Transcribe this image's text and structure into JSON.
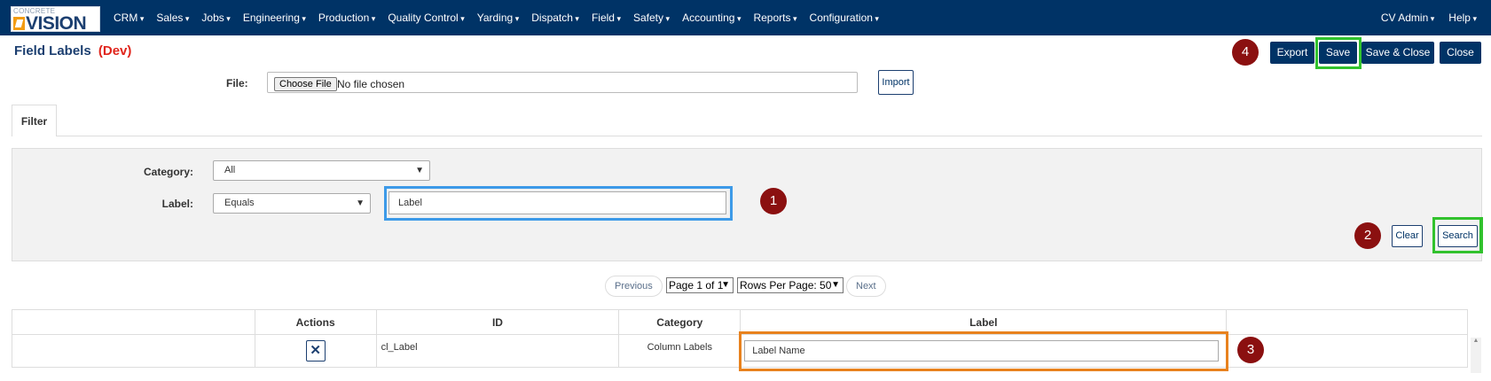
{
  "nav": {
    "logo_small": "CONCRETE",
    "logo_big": "VISION",
    "items": [
      "CRM",
      "Sales",
      "Jobs",
      "Engineering",
      "Production",
      "Quality Control",
      "Yarding",
      "Dispatch",
      "Field",
      "Safety",
      "Accounting",
      "Reports",
      "Configuration"
    ],
    "right_items": [
      "CV Admin",
      "Help"
    ]
  },
  "page": {
    "title": "Field Labels",
    "env": "(Dev)"
  },
  "toolbar": {
    "export": "Export",
    "save": "Save",
    "save_close": "Save & Close",
    "close": "Close"
  },
  "file": {
    "label": "File:",
    "choose": "Choose File",
    "none": "No file chosen",
    "import": "Import"
  },
  "tabs": [
    "Filter"
  ],
  "filter": {
    "category_label": "Category:",
    "category_value": "All",
    "label_label": "Label:",
    "operator_value": "Equals",
    "label_value": "Label",
    "clear": "Clear",
    "search": "Search"
  },
  "pager": {
    "previous": "Previous",
    "page": "Page 1 of 1",
    "rows": "Rows Per Page: 50",
    "next": "Next"
  },
  "table": {
    "headers": [
      "",
      "Actions",
      "ID",
      "Category",
      "Label",
      ""
    ],
    "rows": [
      {
        "id": "cl_Label",
        "category": "Column Labels",
        "label": "Label Name",
        "action": "✕"
      }
    ]
  },
  "annotations": [
    "1",
    "2",
    "3",
    "4"
  ],
  "colors": {
    "nav_bg": "#003366",
    "badge": "#8b1010",
    "highlight_green": "#31c22d",
    "highlight_blue": "#3d9ae8",
    "highlight_orange": "#e8821e",
    "dev_red": "#e0241b"
  }
}
